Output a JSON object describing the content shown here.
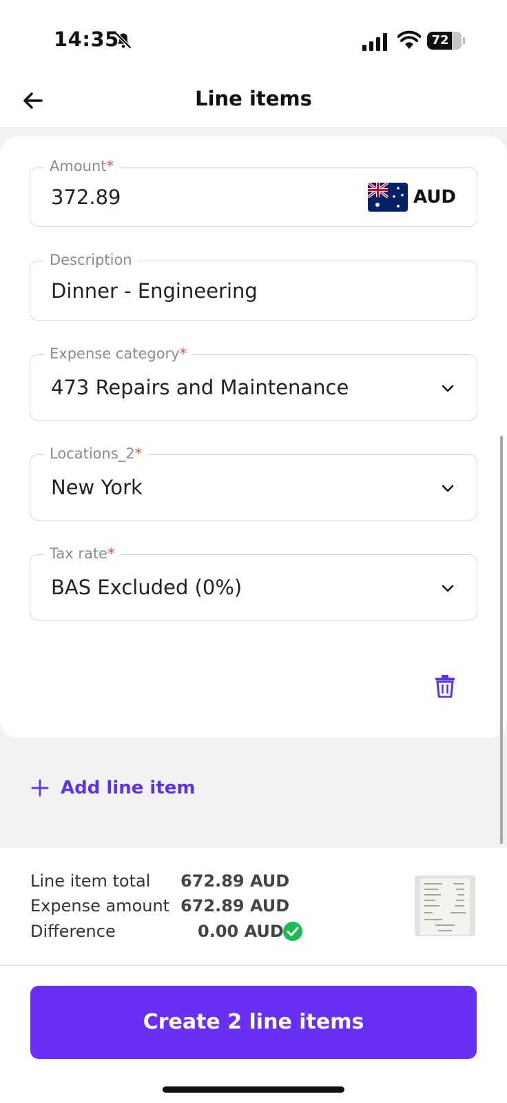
{
  "status": {
    "time": "14:35",
    "battery": "72"
  },
  "header": {
    "title": "Line items"
  },
  "fields": {
    "amount": {
      "label": "Amount",
      "required": "*",
      "value": "372.89",
      "currency": "AUD"
    },
    "description": {
      "label": "Description",
      "value": "Dinner - Engineering"
    },
    "category": {
      "label": "Expense category",
      "required": "*",
      "value": "473 Repairs and Maintenance"
    },
    "location": {
      "label": "Locations_2",
      "required": "*",
      "value": "New York"
    },
    "tax": {
      "label": "Tax rate",
      "required": "*",
      "value": "BAS Excluded (0%)"
    }
  },
  "add_line_item": "Add line item",
  "summary": {
    "line_total_label": "Line item total",
    "line_total_value": "672.89 AUD",
    "expense_label": "Expense amount",
    "expense_value": "672.89 AUD",
    "difference_label": "Difference",
    "difference_value": "0.00 AUD"
  },
  "cta": "Create 2 line items",
  "icons": [
    "bell-slash-icon",
    "signal-icon",
    "wifi-icon",
    "back-arrow-icon",
    "australia-flag-icon",
    "chevron-down-icon",
    "trash-icon",
    "plus-icon",
    "check-circle-icon",
    "receipt-thumbnail"
  ],
  "colors": {
    "accent": "#6a2ff5",
    "link": "#5b32e6",
    "required": "#e04b4b",
    "success": "#1db954"
  }
}
